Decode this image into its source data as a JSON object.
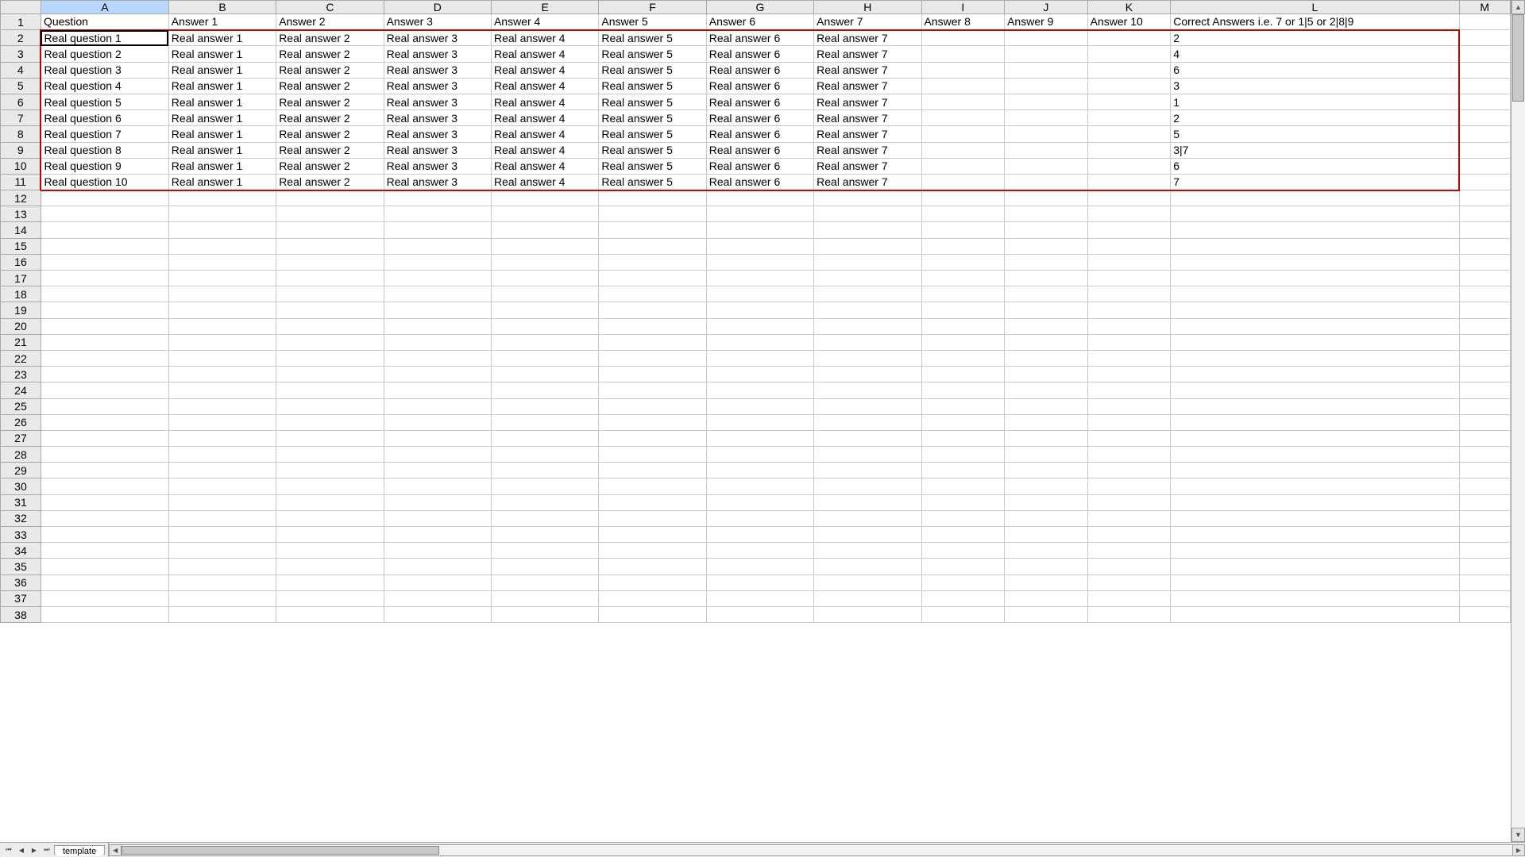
{
  "columns": [
    "A",
    "B",
    "C",
    "D",
    "E",
    "F",
    "G",
    "H",
    "I",
    "J",
    "K",
    "L",
    "M"
  ],
  "headers": {
    "A": "Question",
    "B": "Answer 1",
    "C": "Answer 2",
    "D": "Answer 3",
    "E": "Answer 4",
    "F": "Answer 5",
    "G": "Answer 6",
    "H": "Answer 7",
    "I": "Answer 8",
    "J": "Answer 9",
    "K": "Answer 10",
    "L": "Correct Answers i.e. 7 or 1|5 or 2|8|9",
    "M": ""
  },
  "rows": [
    {
      "q": "Real question 1",
      "a1": "Real answer 1",
      "a2": "Real answer 2",
      "a3": "Real answer 3",
      "a4": "Real answer 4",
      "a5": "Real answer 5",
      "a6": "Real answer 6",
      "a7": "Real answer 7",
      "correct": "2",
      "correct_numeric": true
    },
    {
      "q": "Real question 2",
      "a1": "Real answer 1",
      "a2": "Real answer 2",
      "a3": "Real answer 3",
      "a4": "Real answer 4",
      "a5": "Real answer 5",
      "a6": "Real answer 6",
      "a7": "Real answer 7",
      "correct": "4",
      "correct_numeric": true
    },
    {
      "q": "Real question 3",
      "a1": "Real answer 1",
      "a2": "Real answer 2",
      "a3": "Real answer 3",
      "a4": "Real answer 4",
      "a5": "Real answer 5",
      "a6": "Real answer 6",
      "a7": "Real answer 7",
      "correct": "6",
      "correct_numeric": true
    },
    {
      "q": "Real question 4",
      "a1": "Real answer 1",
      "a2": "Real answer 2",
      "a3": "Real answer 3",
      "a4": "Real answer 4",
      "a5": "Real answer 5",
      "a6": "Real answer 6",
      "a7": "Real answer 7",
      "correct": "3",
      "correct_numeric": true
    },
    {
      "q": "Real question 5",
      "a1": "Real answer 1",
      "a2": "Real answer 2",
      "a3": "Real answer 3",
      "a4": "Real answer 4",
      "a5": "Real answer 5",
      "a6": "Real answer 6",
      "a7": "Real answer 7",
      "correct": "1",
      "correct_numeric": true
    },
    {
      "q": "Real question 6",
      "a1": "Real answer 1",
      "a2": "Real answer 2",
      "a3": "Real answer 3",
      "a4": "Real answer 4",
      "a5": "Real answer 5",
      "a6": "Real answer 6",
      "a7": "Real answer 7",
      "correct": "2",
      "correct_numeric": true
    },
    {
      "q": "Real question 7",
      "a1": "Real answer 1",
      "a2": "Real answer 2",
      "a3": "Real answer 3",
      "a4": "Real answer 4",
      "a5": "Real answer 5",
      "a6": "Real answer 6",
      "a7": "Real answer 7",
      "correct": "5",
      "correct_numeric": true
    },
    {
      "q": "Real question 8",
      "a1": "Real answer 1",
      "a2": "Real answer 2",
      "a3": "Real answer 3",
      "a4": "Real answer 4",
      "a5": "Real answer 5",
      "a6": "Real answer 6",
      "a7": "Real answer 7",
      "correct": "3|7",
      "correct_numeric": false
    },
    {
      "q": "Real question 9",
      "a1": "Real answer 1",
      "a2": "Real answer 2",
      "a3": "Real answer 3",
      "a4": "Real answer 4",
      "a5": "Real answer 5",
      "a6": "Real answer 6",
      "a7": "Real answer 7",
      "correct": "6",
      "correct_numeric": true
    },
    {
      "q": "Real question 10",
      "a1": "Real answer 1",
      "a2": "Real answer 2",
      "a3": "Real answer 3",
      "a4": "Real answer 4",
      "a5": "Real answer 5",
      "a6": "Real answer 6",
      "a7": "Real answer 7",
      "correct": "7",
      "correct_numeric": true
    }
  ],
  "empty_rows_after": 27,
  "last_row_number": 38,
  "active_cell": "A2",
  "highlight": {
    "row_start": 2,
    "row_end": 11,
    "col_start": "A",
    "col_end": "L"
  },
  "sheet_tab": "template",
  "tab_nav": {
    "first": "⏮",
    "prev": "◀",
    "next": "▶",
    "last": "⏭"
  },
  "scroll_arrows": {
    "up": "▲",
    "down": "▼",
    "left": "◀",
    "right": "▶"
  }
}
